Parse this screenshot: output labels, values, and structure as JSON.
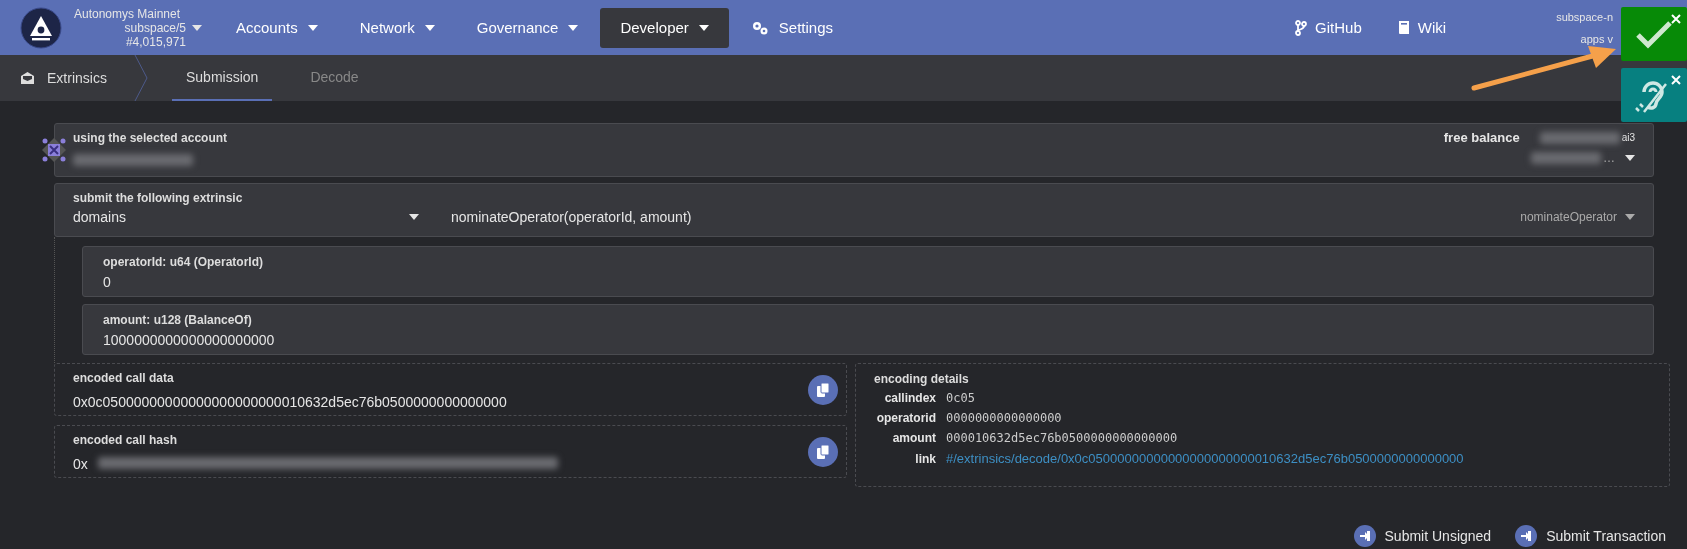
{
  "header": {
    "chain_name": "Autonomys Mainnet",
    "chain_spec": "subspace/5",
    "block": "#4,015,971",
    "nav": [
      {
        "label": "Accounts",
        "menu": true,
        "selected": false
      },
      {
        "label": "Network",
        "menu": true,
        "selected": false
      },
      {
        "label": "Governance",
        "menu": true,
        "selected": false
      },
      {
        "label": "Developer",
        "menu": true,
        "selected": true
      },
      {
        "label": "Settings",
        "menu": false,
        "selected": false,
        "kind": "gears"
      }
    ],
    "links": [
      {
        "label": "GitHub",
        "kind": "branch"
      },
      {
        "label": "Wiki",
        "kind": "book"
      }
    ],
    "node_info": [
      "subspace-n",
      "apps v"
    ]
  },
  "subnav": {
    "section": "Extrinsics",
    "tabs": [
      {
        "label": "Submission",
        "selected": true
      },
      {
        "label": "Decode",
        "selected": false
      }
    ]
  },
  "account": {
    "label": "using the selected account",
    "balance_label": "free balance",
    "balance_unit": "ai3",
    "ellipsis": "…"
  },
  "extrinsic": {
    "label": "submit the following extrinsic",
    "section": "domains",
    "method": "nominateOperator(operatorId, amount)",
    "method_name": "nominateOperator"
  },
  "params": [
    {
      "label": "operatorId: u64 (OperatorId)",
      "value": "0"
    },
    {
      "label": "amount: u128 (BalanceOf)",
      "value": "1000000000000000000000"
    }
  ],
  "encoded": [
    {
      "label": "encoded call data",
      "value": "0x0c05000000000000000000000010632d5ec76b0500000000000000",
      "redacted": false
    },
    {
      "label": "encoded call hash",
      "value": "0x",
      "redacted": true
    }
  ],
  "encoding_details": {
    "title": "encoding details",
    "rows": [
      {
        "label": "callindex",
        "value": "0c05",
        "kind": "mono"
      },
      {
        "label": "operatorid",
        "value": "0000000000000000",
        "kind": "mono"
      },
      {
        "label": "amount",
        "value": "000010632d5ec76b0500000000000000",
        "kind": "mono"
      },
      {
        "label": "link",
        "value": "#/extrinsics/decode/0x0c05000000000000000000000010632d5ec76b0500000000000000",
        "kind": "link"
      }
    ]
  },
  "buttons": [
    "Submit Unsigned",
    "Submit Transaction"
  ]
}
